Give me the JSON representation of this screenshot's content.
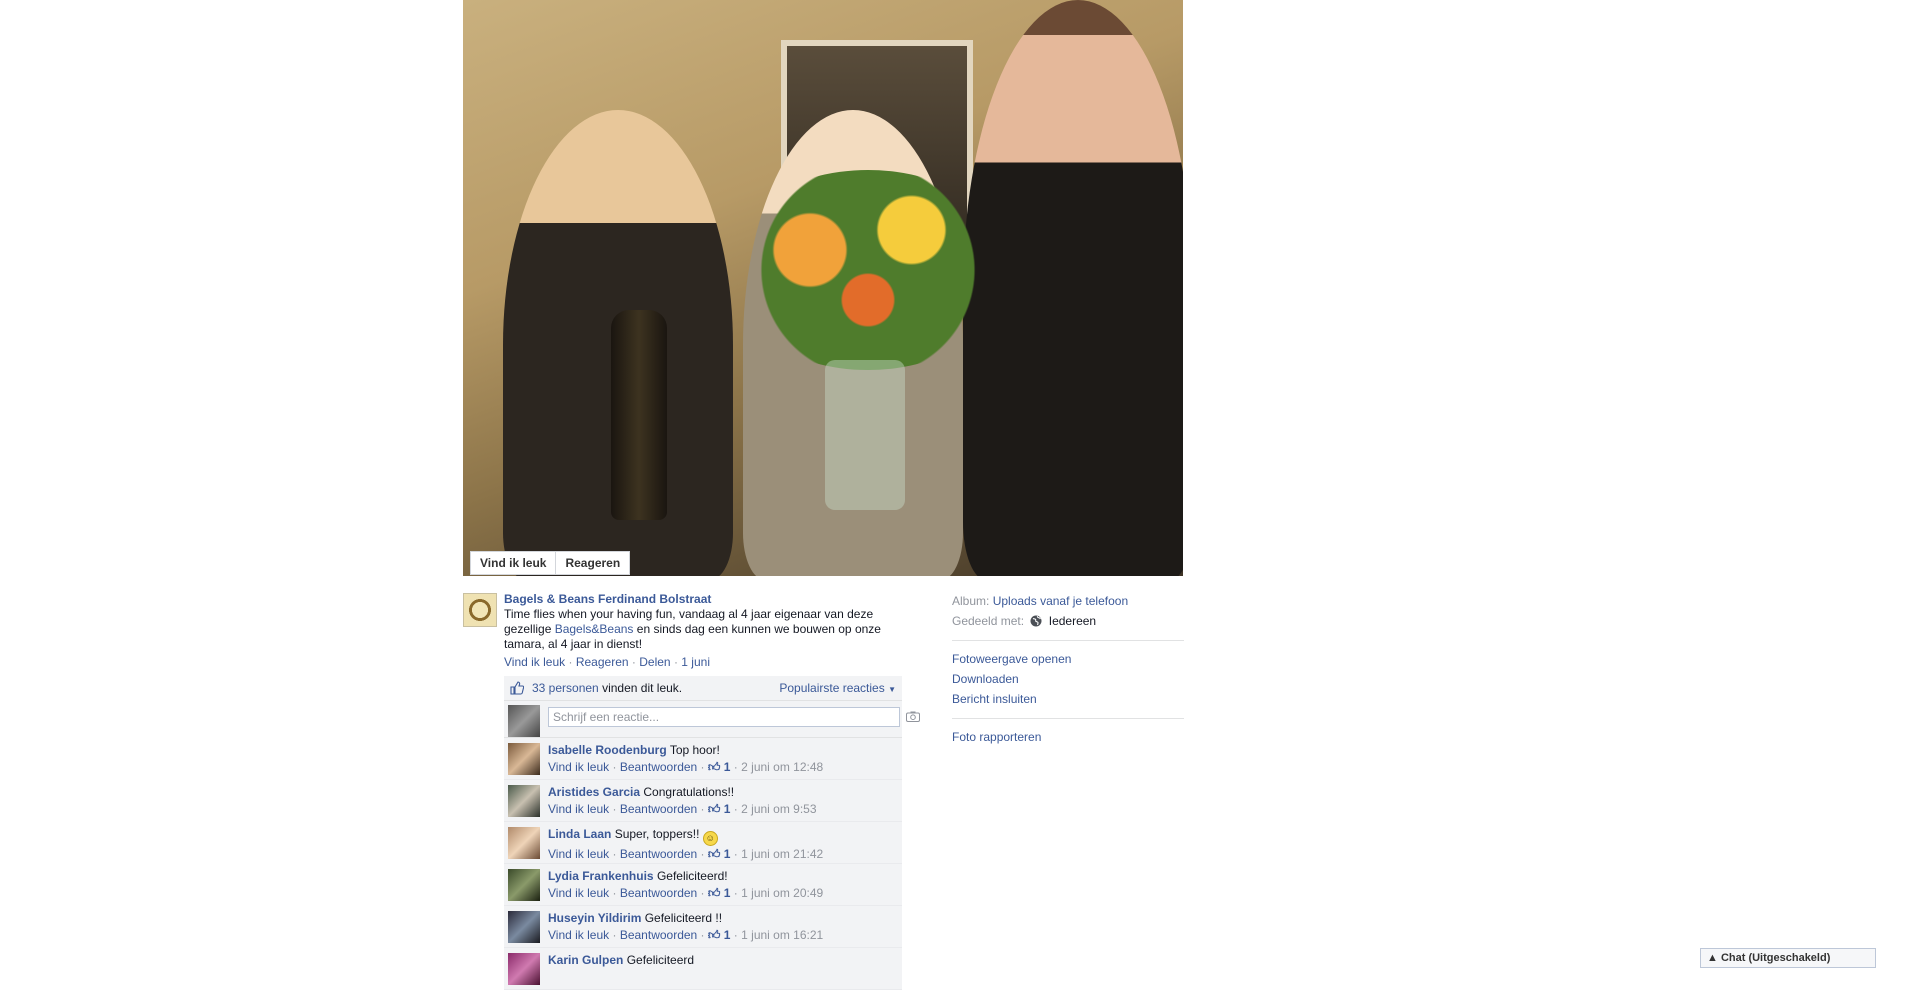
{
  "photo_actions": {
    "like": "Vind ik leuk",
    "comment": "Reageren"
  },
  "post": {
    "author": "Bagels & Beans Ferdinand Bolstraat",
    "text_before": "Time flies when your having fun, vandaag al 4 jaar eigenaar van deze gezellige ",
    "mention": "Bagels&Beans",
    "text_after": " en sinds dag een kunnen we bouwen op onze tamara, al 4 jaar in dienst!",
    "actions": {
      "like": "Vind ik leuk",
      "comment": "Reageren",
      "share": "Delen",
      "time": "1 juni"
    },
    "separator": "·"
  },
  "ufi": {
    "likes_link": "33 personen",
    "likes_text": " vinden dit leuk.",
    "sort_label": "Populairste reacties",
    "composer_placeholder": "Schrijf een reactie..."
  },
  "comments": [
    {
      "author": "Isabelle Roodenburg",
      "text": "Top hoor!",
      "likes": "1",
      "time": "2 juni om 12:48"
    },
    {
      "author": "Aristides Garcia",
      "text": "Congratulations!!",
      "likes": "1",
      "time": "2 juni om 9:53"
    },
    {
      "author": "Linda Laan",
      "text": "Super, toppers!!",
      "likes": "1",
      "time": "1 juni om 21:42"
    },
    {
      "author": "Lydia Frankenhuis",
      "text": "Gefeliciteerd!",
      "likes": "1",
      "time": "1 juni om 20:49"
    },
    {
      "author": "Huseyin Yildirim",
      "text": "Gefeliciteerd !!",
      "likes": "1",
      "time": "1 juni om 16:21"
    },
    {
      "author": "Karin Gulpen",
      "text": "Gefeliciteerd",
      "likes": "",
      "time": ""
    }
  ],
  "comment_actions": {
    "like": "Vind ik leuk",
    "reply": "Beantwoorden"
  },
  "sidebar": {
    "album_label": "Album:",
    "album_value": "Uploads vanaf je telefoon",
    "shared_label": "Gedeeld met:",
    "shared_value": "Iedereen",
    "links": [
      "Fotoweergave openen",
      "Downloaden",
      "Bericht insluiten"
    ],
    "report": "Foto rapporteren"
  },
  "chat": {
    "label": "Chat (Uitgeschakeld)"
  },
  "colors": {
    "link": "#3b5998",
    "meta": "#90949c",
    "ufi_bg": "#f2f3f5"
  }
}
